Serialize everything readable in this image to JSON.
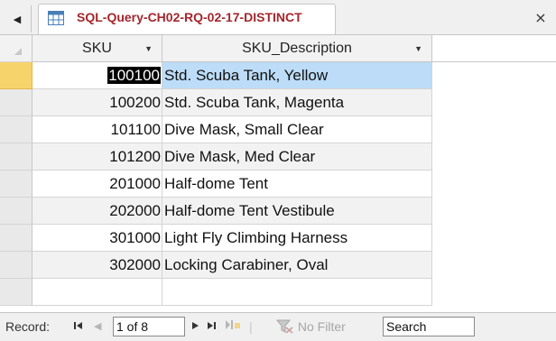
{
  "tab": {
    "scroll_icon": "triangle-left-icon",
    "title": "SQL-Query-CH02-RQ-02-17-DISTINCT",
    "icon": "query-table-icon",
    "close_glyph": "×"
  },
  "columns": [
    {
      "label": "SKU"
    },
    {
      "label": "SKU_Description"
    }
  ],
  "rows": [
    {
      "sku": "100100",
      "description": "Std. Scuba Tank, Yellow"
    },
    {
      "sku": "100200",
      "description": "Std. Scuba Tank, Magenta"
    },
    {
      "sku": "101100",
      "description": "Dive Mask, Small Clear"
    },
    {
      "sku": "101200",
      "description": "Dive Mask, Med Clear"
    },
    {
      "sku": "201000",
      "description": "Half-dome Tent"
    },
    {
      "sku": "202000",
      "description": "Half-dome Tent Vestibule"
    },
    {
      "sku": "301000",
      "description": "Light Fly Climbing Harness"
    },
    {
      "sku": "302000",
      "description": "Locking Carabiner, Oval"
    }
  ],
  "navigation": {
    "record_label": "Record:",
    "position": "1 of 8",
    "first_glyph": "◀",
    "filter_label": "No Filter",
    "search_label": "Search"
  },
  "colors": {
    "tab_title": "#a4262c",
    "current_record_selector": "#f7d36b",
    "selected_cell": "#bcdcf7",
    "alt_row": "#f2f2f2"
  }
}
